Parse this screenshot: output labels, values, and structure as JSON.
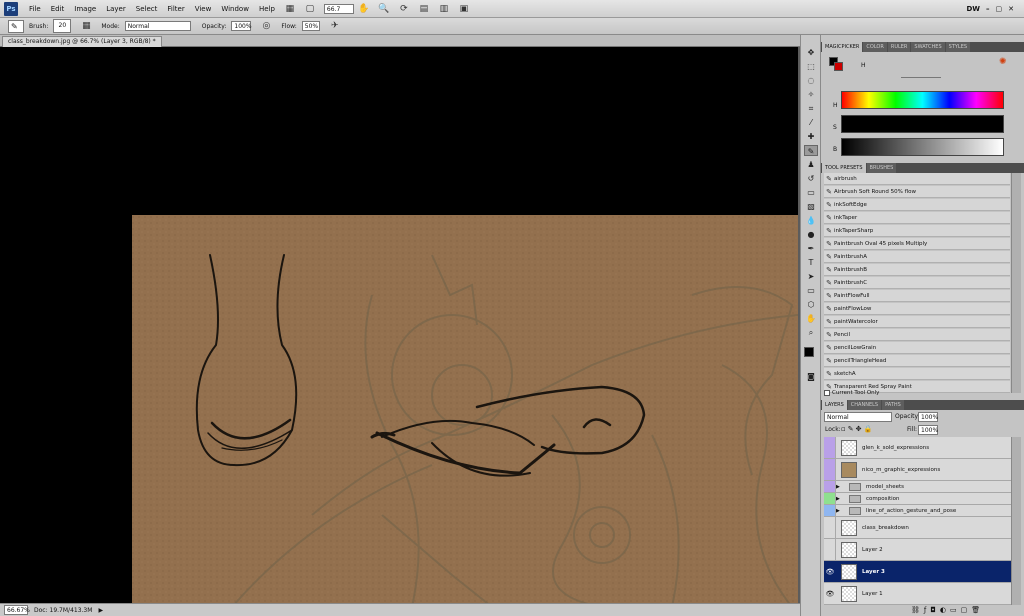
{
  "menu": {
    "logo": "Ps",
    "items": [
      "File",
      "Edit",
      "Image",
      "Layer",
      "Select",
      "Filter",
      "View",
      "Window",
      "Help"
    ],
    "zoom": "66.7",
    "workspace": "DW"
  },
  "options": {
    "brush_label": "Brush:",
    "brush_size": "20",
    "mode_label": "Mode:",
    "mode_value": "Normal",
    "opacity_label": "Opacity:",
    "opacity_value": "100%",
    "flow_label": "Flow:",
    "flow_value": "50%"
  },
  "document": {
    "tab_label": "class_breakdown.jpg @ 66.7% (Layer 3, RGB/8) *"
  },
  "status": {
    "zoom": "66.67%",
    "doc": "Doc: 19.7M/413.3M"
  },
  "color_panel": {
    "tabs": [
      "MAGICPICKER",
      "COLOR",
      "RULER",
      "SWATCHES",
      "STYLES"
    ],
    "h_label": "H",
    "s_label": "S",
    "b_label": "B",
    "colors": {
      "foreground": "#000000",
      "background": "#cc0000"
    }
  },
  "presets_panel": {
    "tabs": [
      "TOOL PRESETS",
      "BRUSHES"
    ],
    "items": [
      "airbrush",
      "Airbrush Soft Round 50% flow",
      "inkSoftEdge",
      "inkTaper",
      "inkTaperSharp",
      "Paintbrush Oval 45 pixels Multiply",
      "PaintbrushA",
      "PaintbrushB",
      "PaintbrushC",
      "PaintFlowFull",
      "paintFlowLow",
      "paintWatercolor",
      "Pencil",
      "pencilLowGrain",
      "pencilTriangleHead",
      "sketchA",
      "Transparent Red Spray Paint"
    ],
    "current_only": "Current Tool Only"
  },
  "layers_panel": {
    "tabs": [
      "LAYERS",
      "CHANNELS",
      "PATHS"
    ],
    "blend_mode": "Normal",
    "opacity_label": "Opacity:",
    "opacity_value": "100%",
    "lock_label": "Lock:",
    "fill_label": "Fill:",
    "fill_value": "100%",
    "layers": [
      {
        "name": "glen_k_sold_expressions",
        "type": "layer"
      },
      {
        "name": "nico_m_graphic_expressions",
        "type": "layer"
      },
      {
        "name": "model_sheets",
        "type": "group"
      },
      {
        "name": "composition",
        "type": "group"
      },
      {
        "name": "line_of_action_gesture_and_pose",
        "type": "group"
      },
      {
        "name": "class_breakdown",
        "type": "layer"
      },
      {
        "name": "Layer 2",
        "type": "layer"
      },
      {
        "name": "Layer 3",
        "type": "layer"
      },
      {
        "name": "Layer 1",
        "type": "layer"
      }
    ]
  }
}
